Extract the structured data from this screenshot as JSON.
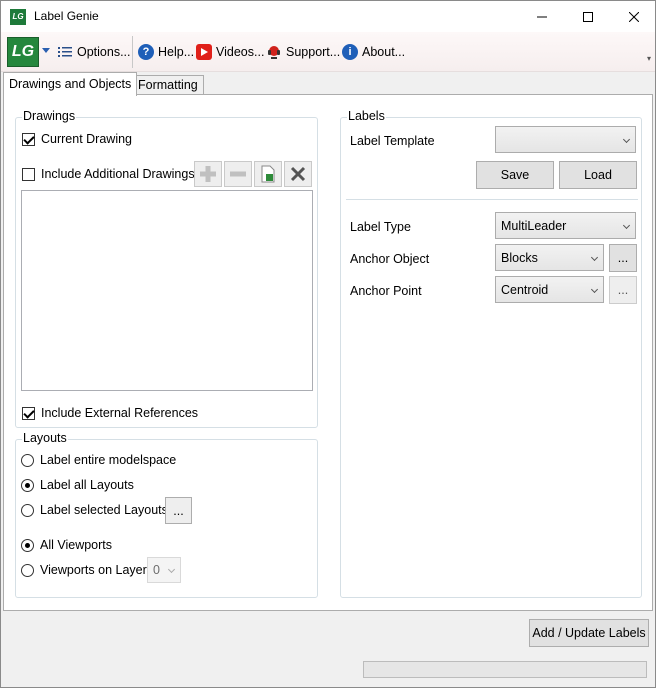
{
  "window": {
    "title": "Label Genie",
    "app_icon_text": "LG"
  },
  "toolbar": {
    "logo_text": "LG",
    "options": "Options...",
    "help": "Help...",
    "videos": "Videos...",
    "support": "Support...",
    "about": "About..."
  },
  "tabs": [
    {
      "label": "Drawings and Objects",
      "active": true
    },
    {
      "label": "Formatting",
      "active": false
    }
  ],
  "drawings": {
    "title": "Drawings",
    "current_drawing": {
      "label": "Current Drawing",
      "checked": true
    },
    "include_additional": {
      "label": "Include Additional Drawings",
      "checked": false
    },
    "include_xrefs": {
      "label": "Include External References",
      "checked": true
    }
  },
  "layouts": {
    "title": "Layouts",
    "options": [
      {
        "label": "Label entire modelspace",
        "checked": false
      },
      {
        "label": "Label all Layouts",
        "checked": true
      },
      {
        "label": "Label selected Layouts",
        "checked": false
      }
    ],
    "browse_label": "...",
    "viewports": [
      {
        "label": "All Viewports",
        "checked": true
      },
      {
        "label": "Viewports on Layer",
        "checked": false
      }
    ],
    "layer_value": "0"
  },
  "labels": {
    "title": "Labels",
    "template_label": "Label Template",
    "template_value": "",
    "save": "Save",
    "load": "Load",
    "type_label": "Label Type",
    "type_value": "MultiLeader",
    "anchor_object_label": "Anchor Object",
    "anchor_object_value": "Blocks",
    "anchor_point_label": "Anchor Point",
    "anchor_point_value": "Centroid",
    "browse_label": "..."
  },
  "footer": {
    "add_update": "Add / Update Labels",
    "progress": 0
  }
}
